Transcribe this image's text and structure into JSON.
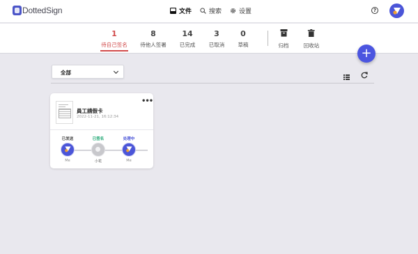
{
  "app": {
    "brand": "DottedSign"
  },
  "nav": {
    "documents": "文件",
    "search": "搜索",
    "settings": "设置",
    "help": "?"
  },
  "tabs": [
    {
      "count": "1",
      "label": "待自己签名",
      "active": true
    },
    {
      "count": "8",
      "label": "待他人签署"
    },
    {
      "count": "14",
      "label": "已完成"
    },
    {
      "count": "3",
      "label": "已取消"
    },
    {
      "count": "0",
      "label": "草稿"
    }
  ],
  "archive": {
    "archive_label": "归档",
    "trash_label": "回收站"
  },
  "fab": {
    "label": "+"
  },
  "filter": {
    "selected": "全部"
  },
  "colors": {
    "accent": "#d14a4a",
    "primary": "#4b55d8",
    "completed": "#1ea672",
    "processing": "#4b55d8"
  },
  "document": {
    "title": "員工請假卡",
    "date": "2022-11-21, 16:12:34",
    "more": "•••",
    "steps": [
      {
        "status": "已发送",
        "name": "Me",
        "status_color": "#444444",
        "avatar": "blue"
      },
      {
        "status": "已签名",
        "name": "小花",
        "status_color": "#1ea672",
        "avatar": "grey"
      },
      {
        "status": "处理中",
        "name": "Me",
        "status_color": "#4b55d8",
        "avatar": "blue"
      }
    ]
  }
}
